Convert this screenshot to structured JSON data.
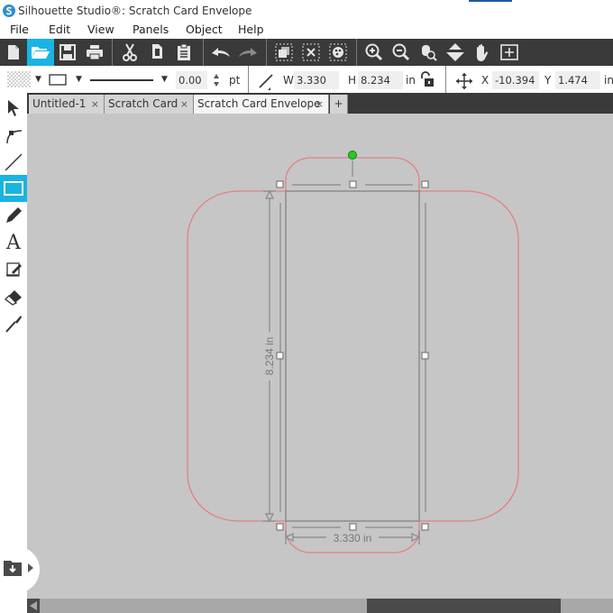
{
  "window": {
    "title": "Silhouette Studio®: Scratch Card Envelope",
    "app_icon": "silhouette-logo-icon"
  },
  "menu": {
    "items": [
      {
        "label": "File"
      },
      {
        "label": "Edit"
      },
      {
        "label": "View"
      },
      {
        "label": "Panels"
      },
      {
        "label": "Object"
      },
      {
        "label": "Help"
      }
    ]
  },
  "toolbar": {
    "buttons": [
      {
        "name": "new-document",
        "icon": "new-document-icon"
      },
      {
        "name": "open",
        "icon": "open-folder-icon",
        "active": true
      },
      {
        "name": "save",
        "icon": "save-icon"
      },
      {
        "name": "print",
        "icon": "print-icon"
      },
      {
        "name": "cut",
        "icon": "scissors-icon"
      },
      {
        "name": "copy",
        "icon": "copy-icon"
      },
      {
        "name": "paste",
        "icon": "paste-icon"
      },
      {
        "name": "undo",
        "icon": "undo-icon"
      },
      {
        "name": "redo",
        "icon": "redo-icon"
      },
      {
        "name": "group",
        "icon": "group-icon"
      },
      {
        "name": "delete-selection",
        "icon": "delete-selection-icon"
      },
      {
        "name": "fill-color",
        "icon": "palette-icon"
      },
      {
        "name": "zoom-in",
        "icon": "zoom-in-icon"
      },
      {
        "name": "zoom-out",
        "icon": "zoom-out-icon"
      },
      {
        "name": "zoom-to-selection",
        "icon": "zoom-selection-icon"
      },
      {
        "name": "fit-to-page",
        "icon": "move-down-icon"
      },
      {
        "name": "pan",
        "icon": "hand-icon"
      },
      {
        "name": "zoom-fit",
        "icon": "fit-screen-icon"
      }
    ],
    "accent": "#19b4e3"
  },
  "properties": {
    "line_thickness": "0.00",
    "line_unit": "pt",
    "width_label": "W",
    "width_value": "3.330",
    "height_label": "H",
    "height_value": "8.234",
    "size_unit": "in",
    "x_label": "X",
    "x_value": "-10.394",
    "y_label": "Y",
    "y_value": "1.474",
    "position_unit": "in"
  },
  "tabs": [
    {
      "label": "Untitled-1",
      "close": "×",
      "active": false
    },
    {
      "label": "Scratch Card",
      "close": "×",
      "active": false
    },
    {
      "label": "Scratch Card Envelope",
      "close": "×",
      "active": true
    },
    {
      "label": "+",
      "is_add": true
    }
  ],
  "left_tools": [
    {
      "name": "select",
      "icon": "pointer-icon"
    },
    {
      "name": "point-edit",
      "icon": "bezier-icon"
    },
    {
      "name": "line",
      "icon": "line-icon"
    },
    {
      "name": "rectangle",
      "icon": "rectangle-icon",
      "active": true
    },
    {
      "name": "draw",
      "icon": "pencil-icon"
    },
    {
      "name": "text",
      "icon": "text-icon"
    },
    {
      "name": "sketch",
      "icon": "sketch-icon"
    },
    {
      "name": "eraser",
      "icon": "eraser-icon"
    },
    {
      "name": "knife",
      "icon": "knife-icon"
    }
  ],
  "canvas": {
    "dimension_width_label": "3.330 in",
    "dimension_height_label": "8.234 in",
    "cut_line_color": "#e07070",
    "rotation_handle_color": "#22cc22"
  },
  "library": {
    "icon": "library-download-icon"
  }
}
